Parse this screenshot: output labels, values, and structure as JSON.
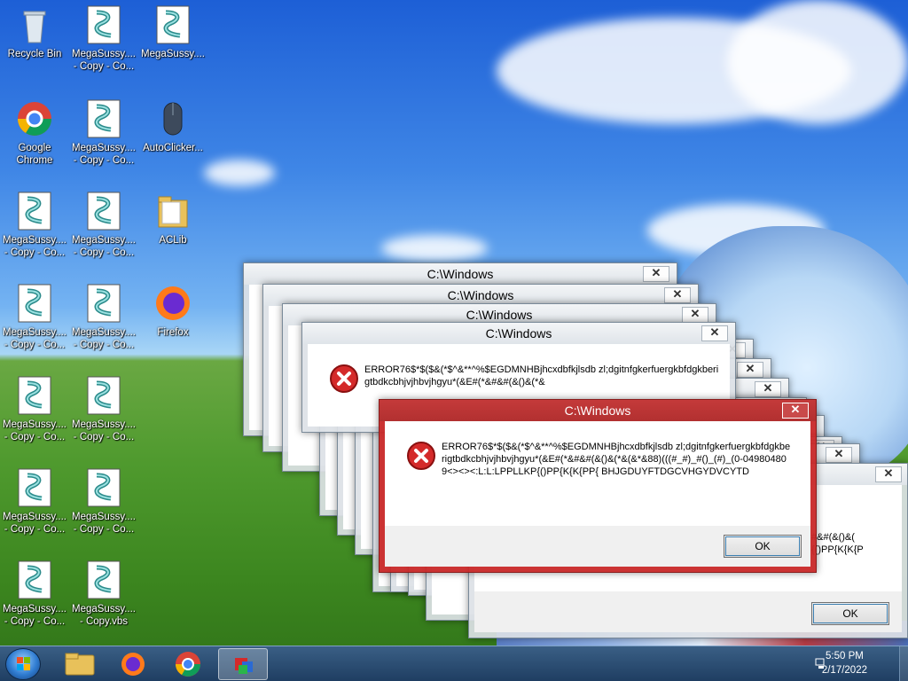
{
  "desktop": {
    "icons": [
      {
        "label": "Recycle Bin",
        "kind": "recycle-bin-icon"
      },
      {
        "label": "MegaSussy....\n- Copy - Co...",
        "kind": "vbs-script-icon"
      },
      {
        "label": "MegaSussy....",
        "kind": "vbs-script-icon"
      },
      {
        "label": "Google\nChrome",
        "kind": "chrome-icon"
      },
      {
        "label": "MegaSussy....\n- Copy - Co...",
        "kind": "vbs-script-icon"
      },
      {
        "label": "AutoClicker...",
        "kind": "mouse-icon"
      },
      {
        "label": "MegaSussy....\n- Copy - Co...",
        "kind": "vbs-script-icon"
      },
      {
        "label": "MegaSussy....\n- Copy - Co...",
        "kind": "vbs-script-icon"
      },
      {
        "label": "ACLib",
        "kind": "folder-icon"
      },
      {
        "label": "MegaSussy....\n- Copy - Co...",
        "kind": "vbs-script-icon"
      },
      {
        "label": "MegaSussy....\n- Copy - Co...",
        "kind": "vbs-script-icon"
      },
      {
        "label": "Firefox",
        "kind": "firefox-icon"
      },
      {
        "label": "MegaSussy....\n- Copy - Co...",
        "kind": "vbs-script-icon"
      },
      {
        "label": "MegaSussy....\n- Copy - Co...",
        "kind": "vbs-script-icon"
      },
      {
        "label": "MegaSussy....\n- Copy - Co...",
        "kind": "vbs-script-icon"
      },
      {
        "label": "MegaSussy....\n- Copy - Co...",
        "kind": "vbs-script-icon"
      },
      {
        "label": "MegaSussy....\n- Copy - Co...",
        "kind": "vbs-script-icon"
      },
      {
        "label": "MegaSussy....\n- Copy.vbs",
        "kind": "vbs-script-icon"
      }
    ]
  },
  "dialog": {
    "title": "C:\\Windows",
    "message_short": "ERROR76$*$($&(*$^&**^%$EGDMNHBjhcxdbfkjlsdb zl;dgitnfgkerfuergkbfdgkberigtbdkcbhjvjhbvjhgyu*(&E#(*&#&#(&()&(*&",
    "message": "ERROR76$*$($&(*$^&**^%$EGDMNHBjhcxdbfkjlsdb zl;dgitnfgkerfuergkbfdgkberigtbdkcbhjvjhbvjhgyu*(&E#(*&#&#(&()&(*&(&*&88)(((#_#)_#()_(#)_(0-049804809<><><:L:L:LPPLLKP{()PP{K{K{PP{ BHJGDUYFTDGCVHGYDVCYTD",
    "partial_right": "#&#(&()&(\n{()PP{K{K{P",
    "ok_label": "OK",
    "close_label": "✕"
  },
  "taskbar": {
    "time": "5:50 PM",
    "date": "2/17/2022",
    "items": [
      "File Explorer",
      "Firefox",
      "Google Chrome",
      "VBScript app"
    ]
  },
  "colors": {
    "error_red": "#d42a2a",
    "active_title": "#b23030"
  }
}
